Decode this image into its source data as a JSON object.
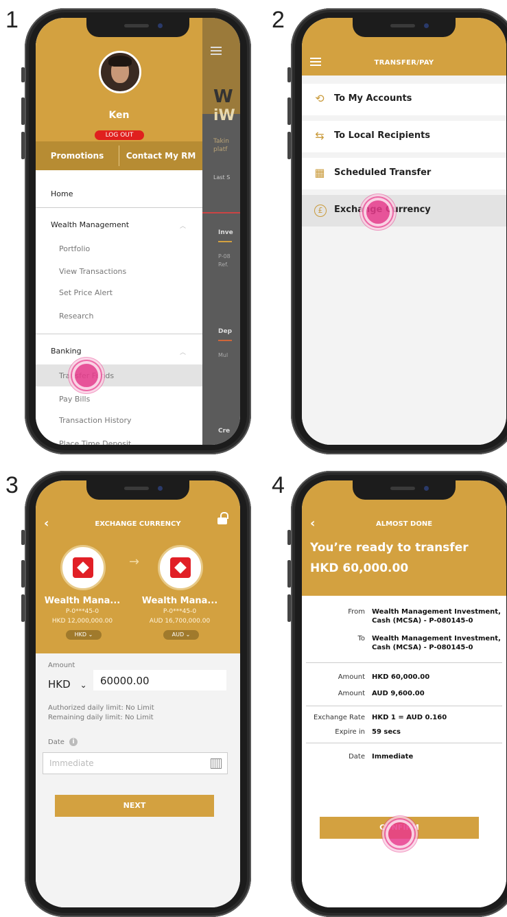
{
  "steps": [
    "1",
    "2",
    "3",
    "4"
  ],
  "screen1": {
    "user_name": "Ken",
    "logout": "LOG OUT",
    "tabs": [
      "Promotions",
      "Contact My RM"
    ],
    "menu": {
      "home": "Home",
      "wealth": "Wealth Management",
      "wealth_items": [
        "Portfolio",
        "View Transactions",
        "Set Price Alert",
        "Research"
      ],
      "banking": "Banking",
      "banking_items": [
        "Transfer Funds",
        "Pay Bills",
        "Transaction History",
        "Place Time Deposit"
      ]
    },
    "background_fragments": {
      "hero_title_1": "W",
      "hero_title_2": "iW",
      "hero_sub_1": "Takin",
      "hero_sub_2": "platf",
      "last": "Last S",
      "inv": "Inve",
      "inv_acc": "P-08",
      "inv_ref": "Ref.",
      "dep": "Dep",
      "dep_sub": "Mul",
      "cred": "Cre"
    }
  },
  "screen2": {
    "title": "TRANSFER/PAY",
    "items": [
      {
        "label": "To My Accounts",
        "icon": "transfer-cycle-icon"
      },
      {
        "label": "To Local Recipients",
        "icon": "arrows-swap-icon"
      },
      {
        "label": "Scheduled Transfer",
        "icon": "building-icon"
      },
      {
        "label": "Exchange Currency",
        "icon": "pound-coin-icon"
      }
    ]
  },
  "screen3": {
    "title": "EXCHANGE CURRENCY",
    "from": {
      "name": "Wealth Mana...",
      "account": "P-0***45-0",
      "balance": "HKD 12,000,000.00",
      "currency": "HKD"
    },
    "to": {
      "name": "Wealth Mana...",
      "account": "P-0***45-0",
      "balance": "AUD 16,700,000.00",
      "currency": "AUD"
    },
    "amount_label": "Amount",
    "amount_currency": "HKD",
    "amount_value": "60000.00",
    "limit_daily": "Authorized daily limit: No Limit",
    "limit_remaining": "Remaining daily limit: No Limit",
    "date_label": "Date",
    "date_placeholder": "Immediate",
    "next": "NEXT"
  },
  "screen4": {
    "title": "ALMOST DONE",
    "headline": "You’re ready to transfer",
    "headline_amount": "HKD 60,000.00",
    "from_label": "From",
    "from_value_1": "Wealth Management Investment,",
    "from_value_2": "Cash (MCSA) - P-080145-0",
    "to_label": "To",
    "to_value_1": "Wealth Management Investment,",
    "to_value_2": "Cash (MCSA) - P-080145-0",
    "amount_label": "Amount",
    "amount_hkd": "HKD 60,000.00",
    "amount_label_2": "Amount",
    "amount_aud": "AUD 9,600.00",
    "rate_label": "Exchange Rate",
    "rate_value": "HKD 1 = AUD 0.160",
    "expire_label": "Expire in",
    "expire_value": "59 secs",
    "date_label": "Date",
    "date_value": "Immediate",
    "confirm": "CONFIRM"
  }
}
